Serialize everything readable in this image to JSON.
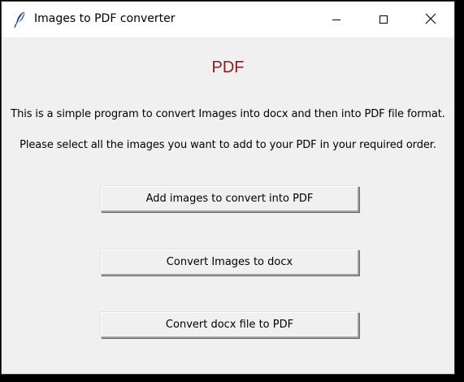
{
  "window": {
    "title": "Images to PDF converter",
    "app_icon": "feather-icon",
    "controls": {
      "minimize_icon": "minimize-icon",
      "maximize_icon": "maximize-icon",
      "close_icon": "close-icon"
    }
  },
  "main": {
    "heading": "PDF",
    "description_line1": "This is a simple program to convert Images into docx and then into PDF file format.",
    "description_line2": "Please select all the images you want to add to your PDF in your required order.",
    "buttons": {
      "add_images": "Add images to convert into PDF",
      "convert_to_docx": "Convert Images to docx",
      "convert_docx_to_pdf": "Convert docx file to PDF"
    }
  },
  "colors": {
    "heading": "#8b1a1a",
    "window_background": "#f0f0f0",
    "titlebar_background": "#ffffff"
  }
}
